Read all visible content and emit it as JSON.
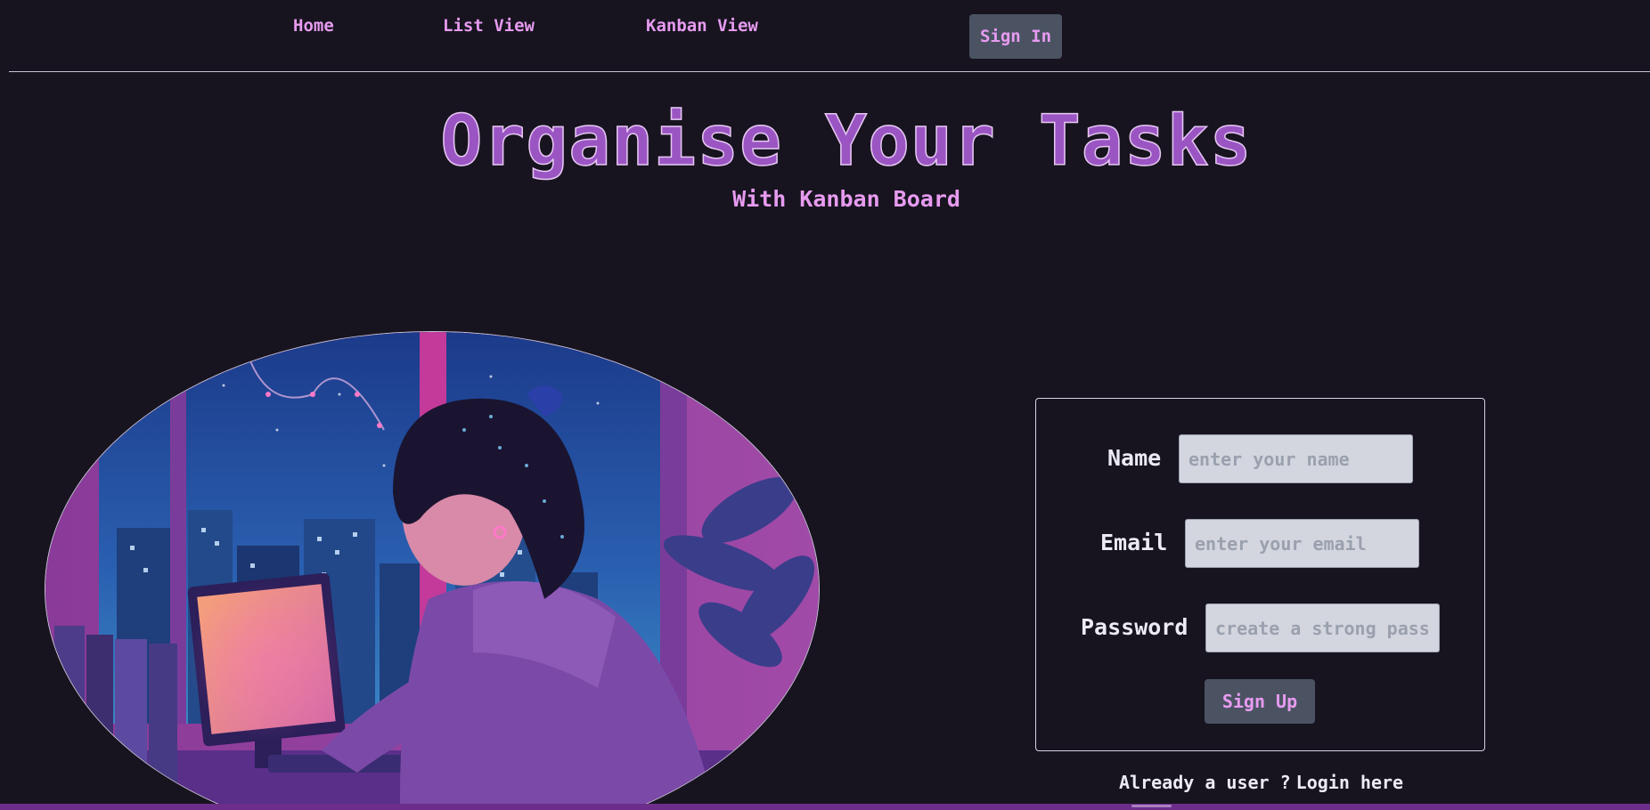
{
  "nav": {
    "home_label": "Home",
    "list_view_label": "List View",
    "kanban_view_label": "Kanban View",
    "sign_in_label": "Sign In"
  },
  "hero": {
    "title": "Organise Your Tasks",
    "subtitle": "With Kanban Board"
  },
  "illustration": {
    "description_icon": "lofi-girl-at-computer-illustration"
  },
  "form": {
    "name_label": "Name",
    "name_placeholder": "enter your name",
    "name_value": "",
    "email_label": "Email",
    "email_placeholder": "enter your email",
    "email_value": "",
    "password_label": "Password",
    "password_placeholder": "create a strong password",
    "password_value": "",
    "submit_label": "Sign Up",
    "login_prompt": "Already a user ?",
    "login_link": "Login here"
  },
  "colors": {
    "background": "#17141f",
    "accent_pink": "#e79bf0",
    "title_purple": "#9a55c3",
    "button_gray": "#4b5363",
    "input_bg": "#d3d6de",
    "bottom_bar": "#6d2d8a"
  }
}
